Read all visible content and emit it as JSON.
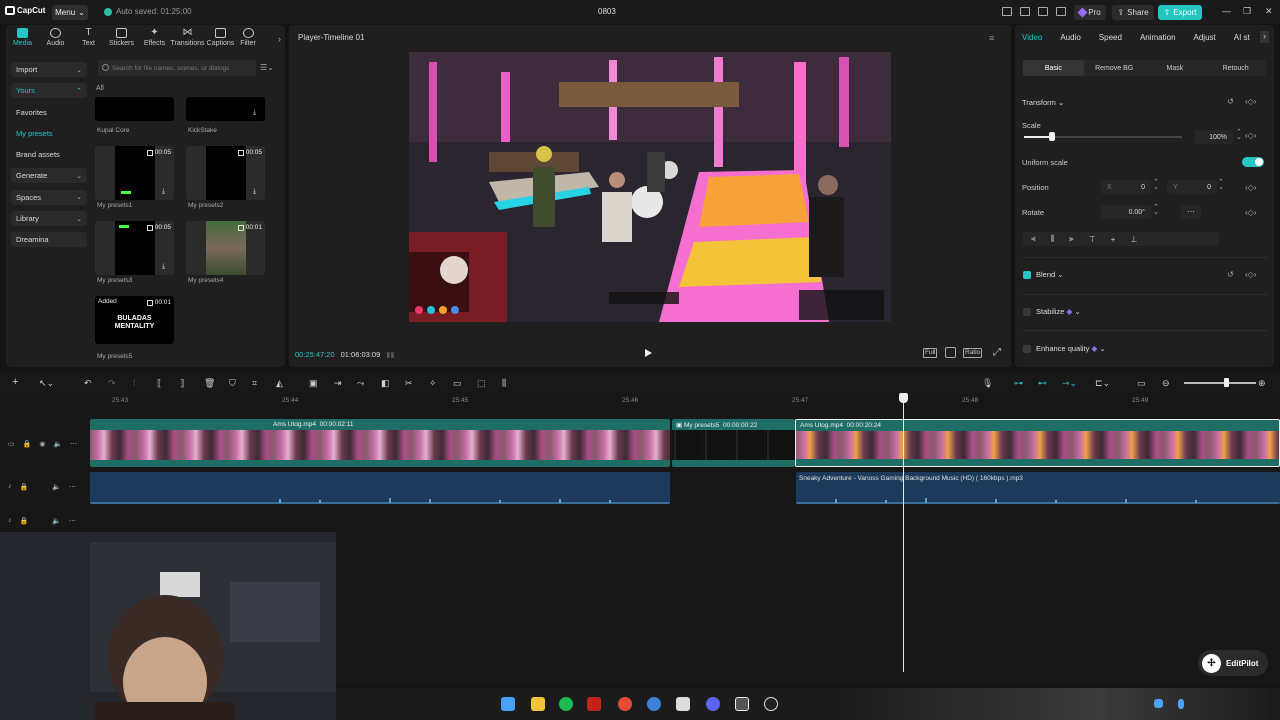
{
  "app": {
    "logo_text": "CapCut",
    "menu_label": "Menu",
    "autosave_text": "Auto saved: 01:25:00",
    "project_title": "0803",
    "pro_label": "Pro",
    "share_label": "Share",
    "export_label": "Export"
  },
  "media_tabs": [
    {
      "label": "Media"
    },
    {
      "label": "Audio"
    },
    {
      "label": "Text"
    },
    {
      "label": "Stickers"
    },
    {
      "label": "Effects"
    },
    {
      "label": "Transitions"
    },
    {
      "label": "Captions"
    },
    {
      "label": "Filter"
    }
  ],
  "sidenav": [
    {
      "label": "Import"
    },
    {
      "label": "Yours"
    },
    {
      "label": "Favorites"
    },
    {
      "label": "My presets"
    },
    {
      "label": "Brand assets"
    },
    {
      "label": "Generate"
    },
    {
      "label": "Spaces"
    },
    {
      "label": "Library"
    },
    {
      "label": "Dreamina"
    }
  ],
  "search": {
    "placeholder": "Search for file names, scenes, or dialogs"
  },
  "filter_all": "All",
  "media_items": [
    {
      "label": "Kupal Core",
      "duration": ""
    },
    {
      "label": "KickStake",
      "duration": ""
    },
    {
      "label": "My presets1",
      "duration": "00:05"
    },
    {
      "label": "My presets2",
      "duration": "00:05"
    },
    {
      "label": "My presets3",
      "duration": "00:05"
    },
    {
      "label": "My presets4",
      "duration": "00:01"
    },
    {
      "label": "My presets5",
      "duration": "00:01",
      "badge": "Added",
      "thumb_text_1": "BULADAS",
      "thumb_text_2": "MENTALITY"
    }
  ],
  "player": {
    "title": "Player-Timeline 01",
    "current_time": "00:25:47:20",
    "total_time": "01:06:03:09",
    "full_label": "Full",
    "ratio_label": "Ratio"
  },
  "inspector": {
    "tabs": [
      "Video",
      "Speed",
      "Animation",
      "Adjust",
      "AI st"
    ],
    "audio_tab": "Audio",
    "subtabs": [
      "Basic",
      "Remove BG",
      "Mask",
      "Retouch"
    ],
    "transform_label": "Transform",
    "scale_label": "Scale",
    "scale_value": "100%",
    "scale_fraction": 0.18,
    "uniform_scale_label": "Uniform scale",
    "position_label": "Position",
    "pos_x_label": "X",
    "pos_x_value": "0",
    "pos_y_label": "Y",
    "pos_y_value": "0",
    "rotate_label": "Rotate",
    "rotate_value": "0.00°",
    "blend_label": "Blend",
    "stabilize_label": "Stabilize",
    "enhance_label": "Enhance quality",
    "accent_color": "#25c6c6"
  },
  "timeline": {
    "ruler": [
      "25:43",
      "25:44",
      "25:45",
      "25:46",
      "25:47",
      "25:48",
      "25:49"
    ],
    "clips": [
      {
        "name": "Ams Utog.mp4",
        "duration": "00:00:02:11"
      },
      {
        "name": "My presets5",
        "duration": "00:00:00:22"
      },
      {
        "name": "Ams Utog.mp4",
        "duration": "00:00:20:24"
      }
    ],
    "audio_clip": {
      "name": "Sneaky Adventure - Vanoss Gaming Background Music (HD) ( 160kbps ).mp3"
    }
  },
  "editpilot_label": "EditPilot"
}
